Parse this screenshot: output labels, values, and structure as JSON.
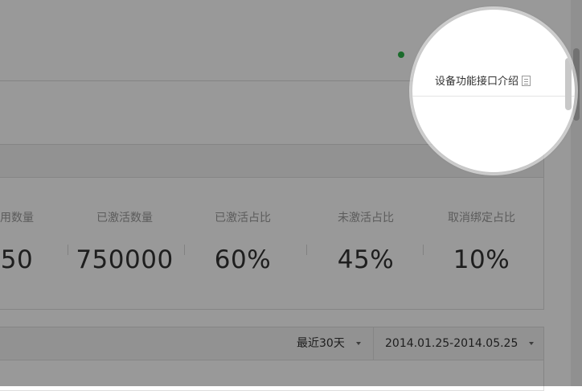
{
  "spotlight": {
    "link_text": "设备功能接口介绍",
    "icon": "document-icon"
  },
  "stats": [
    {
      "label": "用数量",
      "value": "50"
    },
    {
      "label": "已激活数量",
      "value": "750000"
    },
    {
      "label": "已激活占比",
      "value": "60%"
    },
    {
      "label": "未激活占比",
      "value": "45%"
    },
    {
      "label": "取消绑定占比",
      "value": "10%"
    }
  ],
  "chart_toolbar": {
    "range_value": "最近30天",
    "date_value": "2014.01.25-2014.05.25"
  },
  "colors": {
    "overlay": "#000000",
    "accent_green": "#2db34a"
  }
}
